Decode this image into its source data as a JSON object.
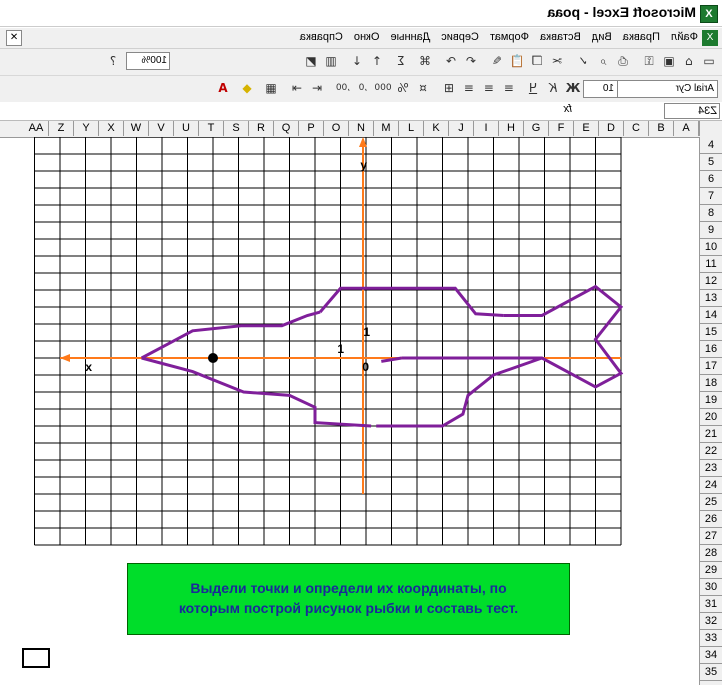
{
  "window": {
    "title": "Microsoft Excel - рoaa"
  },
  "menu": {
    "items": [
      "Файл",
      "Правка",
      "Вид",
      "Вставка",
      "Формат",
      "Сервис",
      "Данные",
      "Окно",
      "Справка"
    ]
  },
  "toolbar": {
    "zoom": "100%"
  },
  "formatting": {
    "font": "Arial Cyr",
    "size": "10"
  },
  "formula_bar": {
    "cell_ref": "Z34",
    "fx": "fx"
  },
  "columns": [
    "A",
    "B",
    "C",
    "D",
    "E",
    "F",
    "G",
    "H",
    "I",
    "J",
    "K",
    "L",
    "M",
    "N",
    "O",
    "P",
    "Q",
    "R",
    "S",
    "T",
    "U",
    "V",
    "W",
    "X",
    "Y",
    "Z",
    "AA"
  ],
  "rows": [
    "4",
    "5",
    "6",
    "7",
    "8",
    "9",
    "10",
    "11",
    "12",
    "13",
    "14",
    "15",
    "16",
    "17",
    "18",
    "19",
    "20",
    "21",
    "22",
    "23",
    "24",
    "25",
    "26",
    "27",
    "28",
    "29",
    "30",
    "31",
    "32",
    "33",
    "34",
    "35"
  ],
  "chart": {
    "y_axis_label": "y",
    "x_axis_label": "x",
    "origin_label": "0",
    "tick_x": "1",
    "tick_y": "1"
  },
  "task": {
    "line1": "Выдели точки и определи их координаты, по",
    "line2": "которым построй рисунок рыбки и составь тест."
  },
  "colors": {
    "axis": "#ff7a1a",
    "fish": "#7f1f9a",
    "task_bg": "#00dd2a",
    "task_text": "#1a2a9a"
  }
}
